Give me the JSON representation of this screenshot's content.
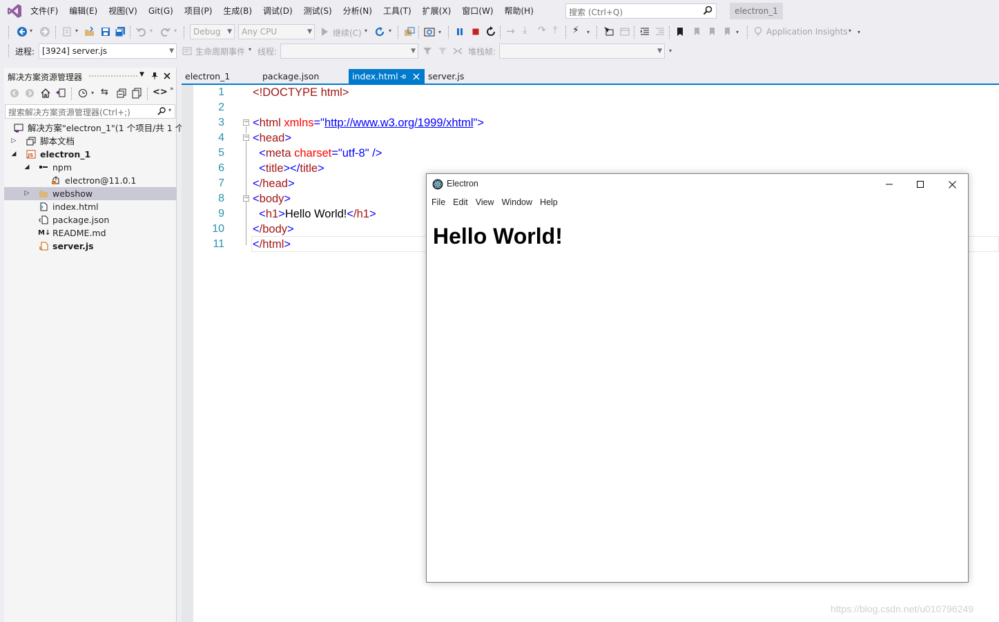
{
  "menu": {
    "items": [
      "文件(F)",
      "编辑(E)",
      "视图(V)",
      "Git(G)",
      "项目(P)",
      "生成(B)",
      "调试(D)",
      "测试(S)",
      "分析(N)",
      "工具(T)",
      "扩展(X)",
      "窗口(W)",
      "帮助(H)"
    ],
    "search_placeholder": "搜索 (Ctrl+Q)",
    "solution_name": "electron_1"
  },
  "toolbar": {
    "configuration": "Debug",
    "platform": "Any CPU",
    "continue_label": "继续(C)",
    "app_insights_label": "Application Insights"
  },
  "debug_bar": {
    "process_label": "进程:",
    "process_value": "[3924] server.js",
    "lifecycle_label": "生命周期事件",
    "thread_label": "线程:",
    "stack_label": "堆栈帧:"
  },
  "solution_explorer": {
    "title": "解决方案资源管理器",
    "search_placeholder": "搜索解决方案资源管理器(Ctrl+;)",
    "tree": [
      {
        "label": "解决方案\"electron_1\"(1 个项目/共 1 个)",
        "icon": "solution-icon",
        "bold": false
      },
      {
        "label": "脚本文档",
        "icon": "script-docs-icon",
        "bold": false
      },
      {
        "label": "electron_1",
        "icon": "js-project-icon",
        "bold": true
      },
      {
        "label": "npm",
        "icon": "npm-icon",
        "bold": false
      },
      {
        "label": "electron@11.0.1",
        "icon": "package-icon",
        "bold": false
      },
      {
        "label": "webshow",
        "icon": "folder-icon",
        "bold": false
      },
      {
        "label": "index.html",
        "icon": "html-file-icon",
        "bold": false
      },
      {
        "label": "package.json",
        "icon": "json-file-icon",
        "bold": false
      },
      {
        "label": "README.md",
        "icon": "markdown-file-icon",
        "bold": false
      },
      {
        "label": "server.js",
        "icon": "js-file-icon",
        "bold": true
      }
    ]
  },
  "editor": {
    "tabs": [
      "electron_1",
      "package.json",
      "index.html",
      "server.js"
    ],
    "active_tab": "index.html",
    "line_numbers": [
      "1",
      "2",
      "3",
      "4",
      "5",
      "6",
      "7",
      "8",
      "9",
      "10",
      "11"
    ],
    "code": {
      "l1_doctype": "<!DOCTYPE html>",
      "l3_open": "<",
      "l3_tag": "html",
      "l3_attr": "xmlns",
      "l3_eq": "=\"",
      "l3_url": "http://www.w3.org/1999/xhtml",
      "l3_close": "\">",
      "l4_tag": "head",
      "l5_tag": "meta",
      "l5_attr": "charset",
      "l5_val": "\"utf-8\"",
      "l5_close": " />",
      "l6_tag_open": "title",
      "l6_tag_close": "title",
      "l7_tag": "/head",
      "l8_tag": "body",
      "l9_tag_open": "h1",
      "l9_text": "Hello World!",
      "l9_tag_close": "/h1",
      "l10_tag": "/body",
      "l11_tag": "/html"
    }
  },
  "electron_window": {
    "title": "Electron",
    "menu": [
      "File",
      "Edit",
      "View",
      "Window",
      "Help"
    ],
    "heading": "Hello World!"
  },
  "watermark": "https://blog.csdn.net/u010796249"
}
